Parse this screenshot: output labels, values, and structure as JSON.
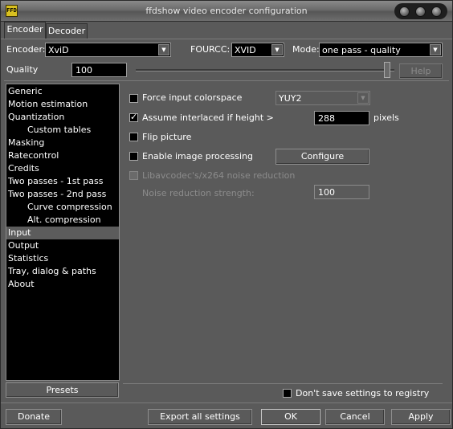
{
  "window": {
    "title": "ffdshow video encoder configuration",
    "app_icon_text": "FFD"
  },
  "tabs": [
    {
      "label": "Encoder"
    },
    {
      "label": "Decoder"
    }
  ],
  "encoder": {
    "encoder_label": "Encoder:",
    "encoder_value": "XviD",
    "fourcc_label": "FOURCC:",
    "fourcc_value": "XVID",
    "mode_label": "Mode:",
    "mode_value": "one pass - quality",
    "quality_label": "Quality",
    "quality_value": "100",
    "quality_fraction": 1.0,
    "help_label": "Help"
  },
  "sidebar": {
    "items": [
      {
        "label": "Generic",
        "sub": false
      },
      {
        "label": "Motion estimation",
        "sub": false
      },
      {
        "label": "Quantization",
        "sub": false
      },
      {
        "label": "Custom tables",
        "sub": true
      },
      {
        "label": "Masking",
        "sub": false
      },
      {
        "label": "Ratecontrol",
        "sub": false
      },
      {
        "label": "Credits",
        "sub": false
      },
      {
        "label": "Two passes - 1st pass",
        "sub": false
      },
      {
        "label": "Two passes - 2nd pass",
        "sub": false
      },
      {
        "label": "Curve compression",
        "sub": true
      },
      {
        "label": "Alt. compression",
        "sub": true
      },
      {
        "label": "Input",
        "sub": false,
        "selected": true
      },
      {
        "label": "Output",
        "sub": false
      },
      {
        "label": "Statistics",
        "sub": false
      },
      {
        "label": "Tray, dialog & paths",
        "sub": false
      },
      {
        "label": "About",
        "sub": false
      }
    ],
    "presets_label": "Presets"
  },
  "input_page": {
    "force_colorspace_label": "Force input colorspace",
    "force_colorspace_checked": false,
    "colorspace_value": "YUY2",
    "interlaced_label": "Assume interlaced if height >",
    "interlaced_checked": true,
    "interlaced_height": "288",
    "pixels_label": "pixels",
    "flip_label": "Flip picture",
    "flip_checked": false,
    "image_processing_label": "Enable image processing",
    "image_processing_checked": false,
    "configure_label": "Configure",
    "noise_reduction_label": "Libavcodec's/x264 noise reduction",
    "noise_strength_label": "Noise reduction strength:",
    "noise_strength_value": "100"
  },
  "footer": {
    "dont_save_label": "Don't save settings to registry",
    "dont_save_checked": false,
    "donate_label": "Donate",
    "export_label": "Export all settings",
    "ok_label": "OK",
    "cancel_label": "Cancel",
    "apply_label": "Apply"
  }
}
